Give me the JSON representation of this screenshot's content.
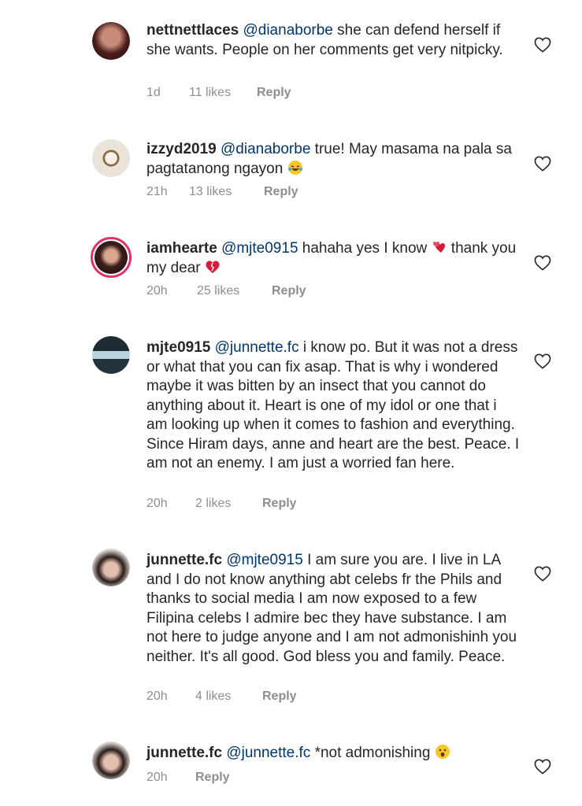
{
  "comments": [
    {
      "username": "nettnettlaces",
      "mention": "@dianaborbe",
      "text": " she can defend herself if she wants. People on her comments get very nitpicky.",
      "time": "1d",
      "likes": "11 likes",
      "reply": "Reply"
    },
    {
      "username": "izzyd2019",
      "mention": "@dianaborbe",
      "text": " true! May masama na pala sa pagtatanong ngayon ",
      "emoji": "laughing-tears",
      "time": "21h",
      "likes": "13 likes",
      "reply": "Reply"
    },
    {
      "username": "iamhearte",
      "mention": "@mjte0915",
      "text": " hahaha yes I know ",
      "text_after": " thank you my dear ",
      "time": "20h",
      "likes": "25 likes",
      "reply": "Reply"
    },
    {
      "username": "mjte0915",
      "mention": "@junnette.fc",
      "text": " i know po. But it was not a dress or what that you can fix asap. That is why i wondered maybe it was bitten by an insect that you cannot do anything about it. Heart is one of my idol or one that i am looking up when it comes to fashion and everything. Since Hiram days, anne and heart are the best. Peace. I am not an enemy. I am just a worried fan here.",
      "time": "20h",
      "likes": "2 likes",
      "reply": "Reply"
    },
    {
      "username": "junnette.fc",
      "mention": "@mjte0915",
      "text": "  I am sure you are. I live in LA and I do not know anything abt celebs fr the Phils and thanks to social media I am now exposed to a few Filipina celebs I admire bec they have substance. I am not here to judge anyone and I am not admonishinh you neither. It's all good. God bless you and family. Peace.",
      "time": "20h",
      "likes": "4 likes",
      "reply": "Reply"
    },
    {
      "username": "junnette.fc",
      "mention": "@junnette.fc",
      "text": " *not admonishing ",
      "time": "20h",
      "likes": "",
      "reply": "Reply"
    }
  ],
  "colors": {
    "text": "#262626",
    "mention": "#00376b",
    "meta": "#8e8e8e",
    "story_ring": "#e1306c"
  },
  "icons": [
    "heart-outline-icon",
    "laughing-tears-emoji",
    "hearts-emoji",
    "broken-heart-emoji",
    "wow-emoji"
  ]
}
